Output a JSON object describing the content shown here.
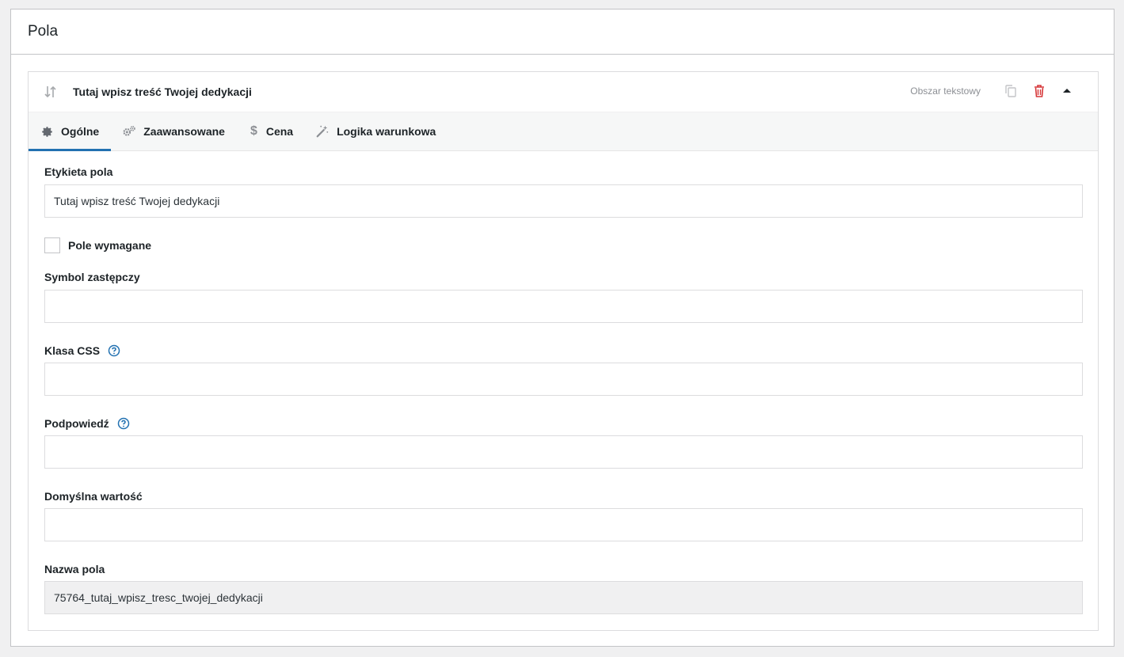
{
  "panel": {
    "title": "Pola"
  },
  "field": {
    "title": "Tutaj wpisz treść Twojej dedykacji",
    "type_label": "Obszar tekstowy",
    "icons": {
      "sort": "sort-icon",
      "copy": "copy-icon",
      "delete": "trash-icon",
      "toggle": "caret-up-icon"
    },
    "colors": {
      "delete": "#d63638",
      "accent": "#2271b1"
    }
  },
  "tabs": [
    {
      "label": "Ogólne",
      "icon": "gear-icon",
      "active": true
    },
    {
      "label": "Zaawansowane",
      "icon": "gears-icon",
      "active": false
    },
    {
      "label": "Cena",
      "icon": "dollar-icon",
      "active": false
    },
    {
      "label": "Logika warunkowa",
      "icon": "magic-wand-icon",
      "active": false
    }
  ],
  "form": {
    "label_field": {
      "label": "Etykieta pola",
      "value": "Tutaj wpisz treść Twojej dedykacji"
    },
    "required": {
      "label": "Pole wymagane",
      "checked": false
    },
    "placeholder_field": {
      "label": "Symbol zastępczy",
      "value": ""
    },
    "css_class": {
      "label": "Klasa CSS",
      "value": ""
    },
    "hint": {
      "label": "Podpowiedź",
      "value": ""
    },
    "default_value": {
      "label": "Domyślna wartość",
      "value": ""
    },
    "field_name": {
      "label": "Nazwa pola",
      "value": "75764_tutaj_wpisz_tresc_twojej_dedykacji"
    }
  }
}
